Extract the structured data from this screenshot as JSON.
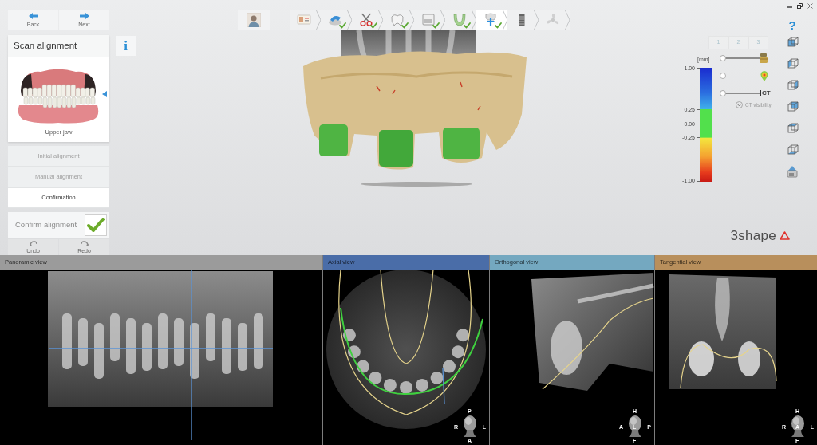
{
  "nav": {
    "back": "Back",
    "next": "Next"
  },
  "info_button": "i",
  "alignment_card": {
    "title": "Scan alignment",
    "jaw_label": "Upper jaw"
  },
  "alignment_steps": [
    {
      "label": "Initial alignment",
      "selected": false
    },
    {
      "label": "Manual alignment",
      "selected": false
    },
    {
      "label": "Confirmation",
      "selected": true
    }
  ],
  "confirm": {
    "label": "Confirm alignment",
    "checked": true
  },
  "history": {
    "undo": "Undo",
    "redo": "Redo"
  },
  "workflow_steps": [
    {
      "kind": "form",
      "done": false,
      "selected": false,
      "disabled": false
    },
    {
      "kind": "scanner",
      "done": true,
      "selected": false,
      "disabled": false
    },
    {
      "kind": "scissors",
      "done": true,
      "selected": false,
      "disabled": false
    },
    {
      "kind": "crown",
      "done": true,
      "selected": false,
      "disabled": false
    },
    {
      "kind": "box",
      "done": true,
      "selected": false,
      "disabled": false
    },
    {
      "kind": "arch",
      "done": true,
      "selected": false,
      "disabled": false
    },
    {
      "kind": "planning",
      "done": true,
      "selected": true,
      "disabled": false
    },
    {
      "kind": "implant",
      "done": false,
      "selected": false,
      "disabled": false
    },
    {
      "kind": "fan",
      "done": false,
      "selected": false,
      "disabled": true
    }
  ],
  "help_button": "?",
  "view_tabs": [
    {
      "label": "1",
      "selected": false
    },
    {
      "label": "2",
      "selected": false
    },
    {
      "label": "3",
      "selected": false
    }
  ],
  "color_scale": {
    "unit": "[mm]",
    "ticks": [
      "1.00",
      "0.25",
      "0.00",
      "-0.25",
      "-1.00"
    ]
  },
  "layers": [
    {
      "kind": "implant",
      "level": 0
    },
    {
      "kind": "deviation",
      "on": false
    },
    {
      "kind": "ct",
      "label": "CT",
      "level": 0
    }
  ],
  "ct_visibility": "CT visibility",
  "logo": "3shape",
  "views": [
    {
      "title": "Panoramic view",
      "kind": "panoramic",
      "color": "#9b9b9b"
    },
    {
      "title": "Axial view",
      "kind": "axial",
      "color": "#4a6da8",
      "orientation": {
        "top": "P",
        "left": "R",
        "right": "L",
        "bottom": "A"
      }
    },
    {
      "title": "Orthogonal view",
      "kind": "orthogonal",
      "color": "#74a8c0",
      "orientation": {
        "top": "H",
        "left": "A",
        "center": "L",
        "right": "P",
        "bottom": "F"
      }
    },
    {
      "title": "Tangential view",
      "kind": "tangential",
      "color": "#b88f5c",
      "orientation": {
        "top": "H",
        "left": "R",
        "center": "A",
        "right": "L",
        "bottom": "F"
      }
    }
  ]
}
